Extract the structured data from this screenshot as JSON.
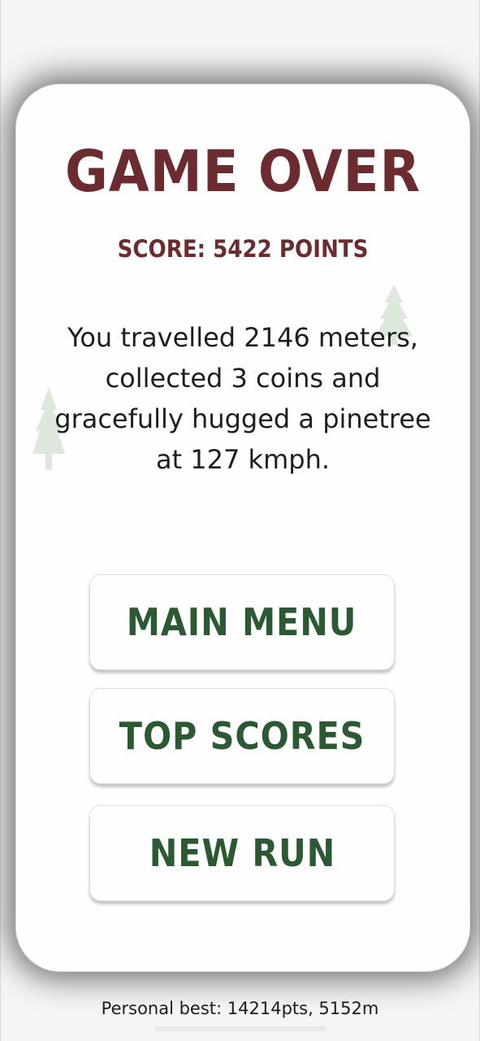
{
  "title": "GAME OVER",
  "score_line": "SCORE: 5422 POINTS",
  "summary": {
    "line1": "You travelled 2146 meters,",
    "line2": "collected 3 coins and",
    "line3": "gracefully hugged a pinetree",
    "line4": "at 127 kmph."
  },
  "buttons": {
    "main_menu": "MAIN MENU",
    "top_scores": "TOP SCORES",
    "new_run": "NEW RUN"
  },
  "personal_best": "Personal best: 14214pts, 5152m",
  "colors": {
    "title": "#6b2b2f",
    "button_text": "#2b5a32",
    "tree": "#d9e8d6"
  },
  "icons": [
    "pine-tree-icon",
    "pine-tree-icon"
  ]
}
